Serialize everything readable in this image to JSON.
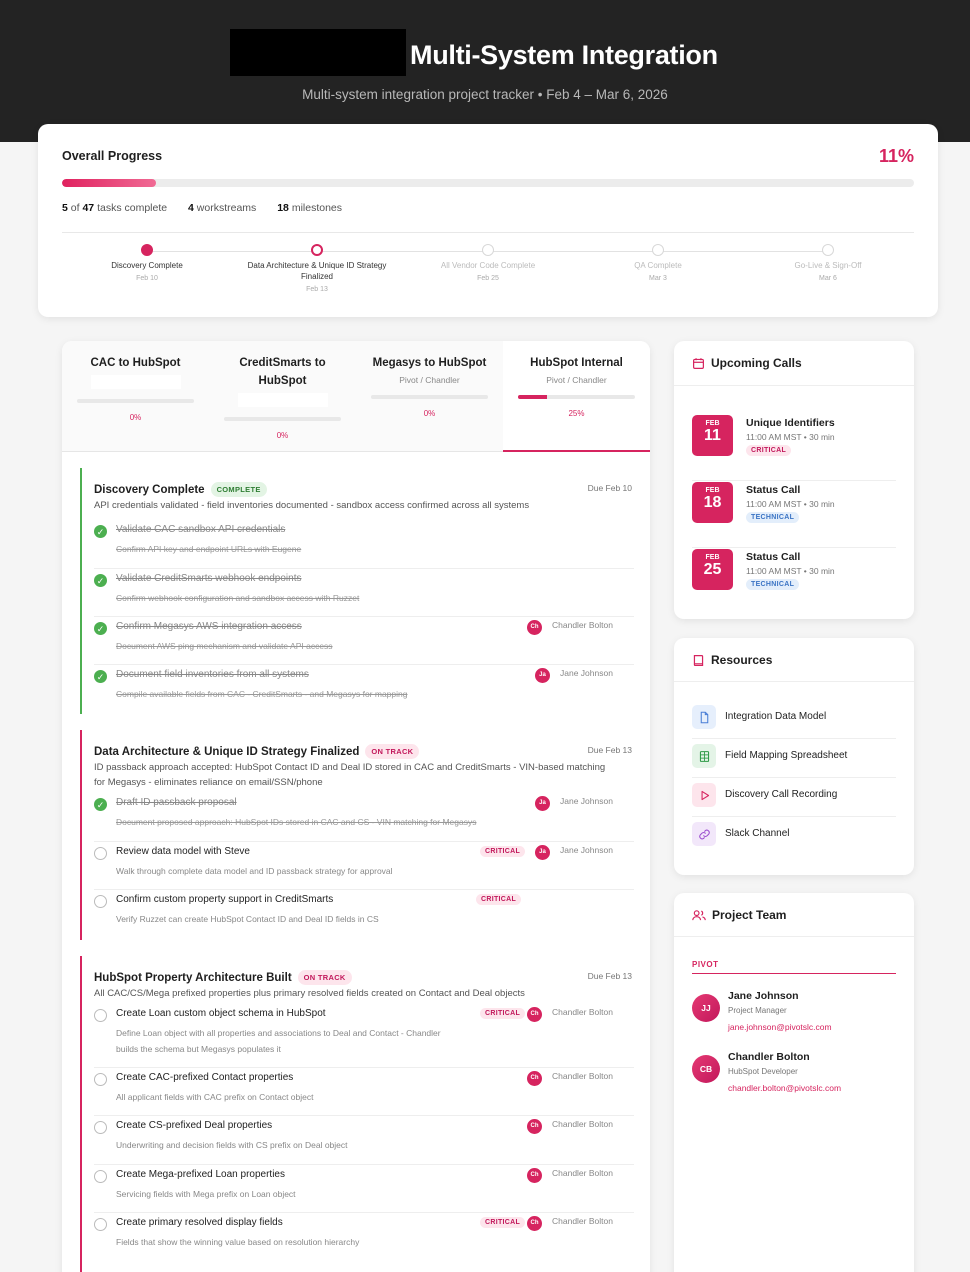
{
  "header": {
    "title": "Multi-System Integration",
    "subtitle": "Multi-system integration project tracker • Feb 4 – Mar 6, 2026"
  },
  "overall": {
    "title": "Overall Progress",
    "percent_label": "11%",
    "progress": 0.11,
    "tasks_done": "5",
    "tasks_of": "of",
    "tasks_total": "47",
    "tasks_suffix": "tasks complete",
    "workstreams_count": "4",
    "workstreams_label": "workstreams",
    "milestones_count": "18",
    "milestones_label": "milestones"
  },
  "milestones": [
    {
      "label": "Discovery Complete",
      "date": "Feb 10",
      "state": "done"
    },
    {
      "label": "Data Architecture & Unique ID Strategy Finalized",
      "date": "Feb 13",
      "state": "current"
    },
    {
      "label": "All Vendor Code Complete",
      "date": "Feb 25",
      "state": "pending"
    },
    {
      "label": "QA Complete",
      "date": "Mar 3",
      "state": "pending"
    },
    {
      "label": "Go-Live & Sign-Off",
      "date": "Mar 6",
      "state": "pending"
    }
  ],
  "workstreams": [
    {
      "name": "CAC to HubSpot",
      "sub": "",
      "pct": "0%",
      "progress": 0
    },
    {
      "name": "CreditSmarts to HubSpot",
      "sub": "",
      "pct": "0%",
      "progress": 0
    },
    {
      "name": "Megasys to HubSpot",
      "sub": "Pivot / Chandler",
      "pct": "0%",
      "progress": 0
    },
    {
      "name": "HubSpot Internal",
      "sub": "Pivot / Chandler",
      "pct": "25%",
      "progress": 0.25
    }
  ],
  "sections": [
    {
      "title": "Discovery Complete",
      "badge": "COMPLETE",
      "due": "Due Feb 10",
      "desc": "API credentials validated - field inventories documented - sandbox access confirmed across all systems",
      "tasks": [
        {
          "title": "Validate CAC sandbox API credentials",
          "desc": "Confirm API key and endpoint URLs with Eugene",
          "done": true
        },
        {
          "title": "Validate CreditSmarts webhook endpoints",
          "desc": "Confirm webhook configuration and sandbox access with Ruzzet",
          "done": true
        },
        {
          "title": "Confirm Megasys AWS integration access",
          "desc": "Document AWS ping mechanism and validate API access",
          "done": true,
          "initials": "Ch",
          "assignee": "Chandler Bolton"
        },
        {
          "title": "Document field inventories from all systems",
          "desc": "Compile available fields from CAC - CreditSmarts - and Megasys for mapping",
          "done": true,
          "initials": "Ja",
          "assignee": "Jane Johnson"
        }
      ]
    },
    {
      "title": "Data Architecture & Unique ID Strategy Finalized",
      "badge": "ON TRACK",
      "due": "Due Feb 13",
      "desc": "ID passback approach accepted: HubSpot Contact ID and Deal ID stored in CAC and CreditSmarts - VIN-based matching for Megasys - eliminates reliance on email/SSN/phone",
      "tasks": [
        {
          "title": "Draft ID passback proposal",
          "desc": "Document proposed approach: HubSpot IDs stored in CAC and CS - VIN matching for Megasys",
          "done": true,
          "initials": "Ja",
          "assignee": "Jane Johnson"
        },
        {
          "title": "Review data model with Steve",
          "desc": "Walk through complete data model and ID passback strategy for approval",
          "done": false,
          "critical": "CRITICAL",
          "initials": "Ja",
          "assignee": "Jane Johnson"
        },
        {
          "title": "Confirm custom property support in CreditSmarts",
          "desc": "Verify Ruzzet can create HubSpot Contact ID and Deal ID fields in CS",
          "done": false,
          "critical": "CRITICAL"
        }
      ]
    },
    {
      "title": "HubSpot Property Architecture Built",
      "badge": "ON TRACK",
      "due": "Due Feb 13",
      "desc": "All CAC/CS/Mega prefixed properties plus primary resolved fields created on Contact and Deal objects",
      "tasks": [
        {
          "title": "Create Loan custom object schema in HubSpot",
          "desc": "Define Loan object with all properties and associations to Deal and Contact - Chandler builds the schema but Megasys populates it",
          "done": false,
          "critical": "CRITICAL",
          "initials": "Ch",
          "assignee": "Chandler Bolton"
        },
        {
          "title": "Create CAC-prefixed Contact properties",
          "desc": "All applicant fields with CAC prefix on Contact object",
          "done": false,
          "initials": "Ch",
          "assignee": "Chandler Bolton"
        },
        {
          "title": "Create CS-prefixed Deal properties",
          "desc": "Underwriting and decision fields with CS prefix on Deal object",
          "done": false,
          "initials": "Ch",
          "assignee": "Chandler Bolton"
        },
        {
          "title": "Create Mega-prefixed Loan properties",
          "desc": "Servicing fields with Mega prefix on Loan object",
          "done": false,
          "initials": "Ch",
          "assignee": "Chandler Bolton"
        },
        {
          "title": "Create primary resolved display fields",
          "desc": "Fields that show the winning value based on resolution hierarchy",
          "done": false,
          "critical": "CRITICAL",
          "initials": "Ch",
          "assignee": "Chandler Bolton"
        }
      ]
    }
  ],
  "calls": {
    "title": "Upcoming Calls",
    "items": [
      {
        "mon": "FEB",
        "day": "11",
        "title": "Unique Identifiers",
        "time": "11:00 AM MST • 30 min",
        "tag": "CRITICAL"
      },
      {
        "mon": "FEB",
        "day": "18",
        "title": "Status Call",
        "time": "11:00 AM MST • 30 min",
        "tag": "TECHNICAL"
      },
      {
        "mon": "FEB",
        "day": "25",
        "title": "Status Call",
        "time": "11:00 AM MST • 30 min",
        "tag": "TECHNICAL"
      }
    ]
  },
  "resources": {
    "title": "Resources",
    "items": [
      {
        "label": "Integration Data Model",
        "icon": "document-icon",
        "color": "#4a7fd6",
        "bg": "#e6effc"
      },
      {
        "label": "Field Mapping Spreadsheet",
        "icon": "spreadsheet-icon",
        "color": "#2e9a47",
        "bg": "#e4f4e7"
      },
      {
        "label": "Discovery Call Recording",
        "icon": "play-icon",
        "color": "#d6245f",
        "bg": "#fde5ec"
      },
      {
        "label": "Slack Channel",
        "icon": "link-icon",
        "color": "#9c4fd0",
        "bg": "#f2e7fa"
      }
    ]
  },
  "team": {
    "title": "Project Team",
    "group": "PIVOT",
    "members": [
      {
        "initials": "JJ",
        "name": "Jane Johnson",
        "role": "Project Manager",
        "email": "jane.johnson@pivotslc.com"
      },
      {
        "initials": "CB",
        "name": "Chandler Bolton",
        "role": "HubSpot Developer",
        "email": "chandler.bolton@pivotslc.com"
      }
    ]
  },
  "colors": {
    "accent": "#d6245f",
    "complete": "#4caf50",
    "header_bg": "#232323"
  }
}
